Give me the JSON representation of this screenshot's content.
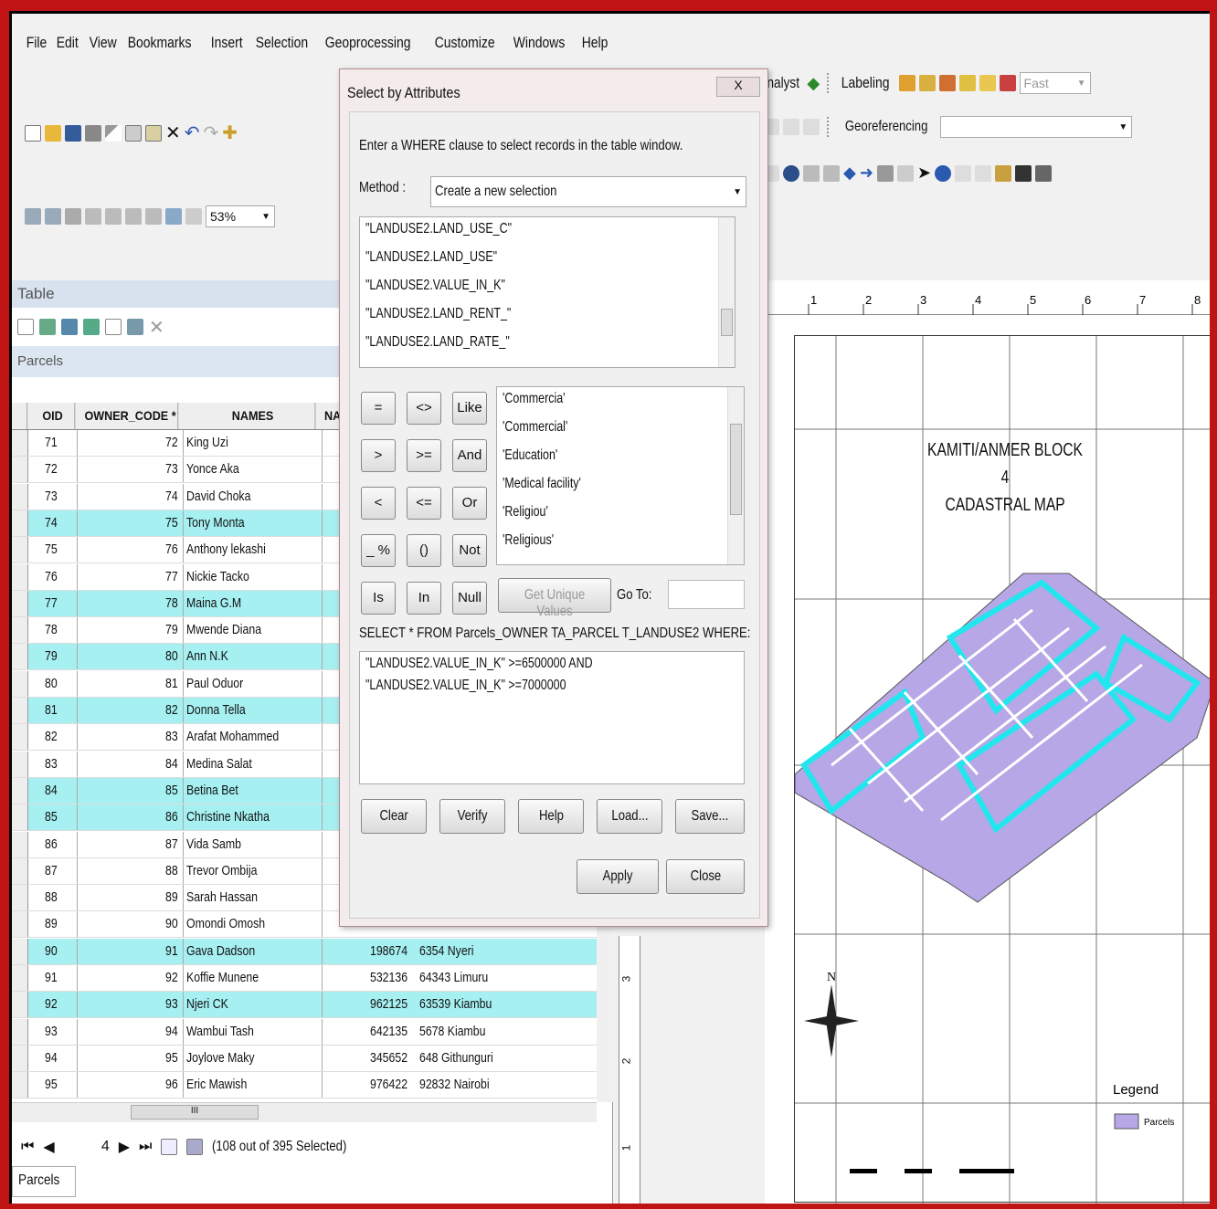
{
  "menu": [
    "File",
    "Edit",
    "View",
    "Bookmarks",
    "Insert",
    "Selection",
    "Geoprocessing",
    "Customize",
    "Windows",
    "Help"
  ],
  "toolbar": {
    "zoom": "53%",
    "analyst": "nalyst",
    "labeling": "Labeling",
    "fast": "Fast",
    "georeferencing": "Georeferencing"
  },
  "table": {
    "window_title": "Table",
    "tab": "Parcels",
    "columns": [
      "OID",
      "OWNER_CODE *",
      "NAMES",
      "NA"
    ],
    "rows": [
      {
        "oid": "71",
        "code": "72",
        "name": "King Uzi",
        "v1": "",
        "v2": "",
        "sel": false
      },
      {
        "oid": "72",
        "code": "73",
        "name": "Yonce Aka",
        "v1": "",
        "v2": "",
        "sel": false
      },
      {
        "oid": "73",
        "code": "74",
        "name": "David Choka",
        "v1": "",
        "v2": "",
        "sel": false
      },
      {
        "oid": "74",
        "code": "75",
        "name": "Tony Monta",
        "v1": "",
        "v2": "",
        "sel": true
      },
      {
        "oid": "75",
        "code": "76",
        "name": "Anthony lekashi",
        "v1": "",
        "v2": "",
        "sel": false
      },
      {
        "oid": "76",
        "code": "77",
        "name": "Nickie Tacko",
        "v1": "",
        "v2": "",
        "sel": false
      },
      {
        "oid": "77",
        "code": "78",
        "name": "Maina G.M",
        "v1": "",
        "v2": "",
        "sel": true
      },
      {
        "oid": "78",
        "code": "79",
        "name": "Mwende Diana",
        "v1": "",
        "v2": "",
        "sel": false
      },
      {
        "oid": "79",
        "code": "80",
        "name": "Ann N.K",
        "v1": "",
        "v2": "",
        "sel": true
      },
      {
        "oid": "80",
        "code": "81",
        "name": "Paul Oduor",
        "v1": "",
        "v2": "",
        "sel": false
      },
      {
        "oid": "81",
        "code": "82",
        "name": "Donna Tella",
        "v1": "",
        "v2": "",
        "sel": true
      },
      {
        "oid": "82",
        "code": "83",
        "name": "Arafat Mohammed",
        "v1": "",
        "v2": "",
        "sel": false
      },
      {
        "oid": "83",
        "code": "84",
        "name": "Medina Salat",
        "v1": "",
        "v2": "",
        "sel": false
      },
      {
        "oid": "84",
        "code": "85",
        "name": "Betina Bet",
        "v1": "",
        "v2": "",
        "sel": true
      },
      {
        "oid": "85",
        "code": "86",
        "name": "Christine Nkatha",
        "v1": "",
        "v2": "",
        "sel": true
      },
      {
        "oid": "86",
        "code": "87",
        "name": "Vida Samb",
        "v1": "",
        "v2": "",
        "sel": false
      },
      {
        "oid": "87",
        "code": "88",
        "name": "Trevor Ombija",
        "v1": "",
        "v2": "",
        "sel": false
      },
      {
        "oid": "88",
        "code": "89",
        "name": "Sarah Hassan",
        "v1": "",
        "v2": "",
        "sel": false
      },
      {
        "oid": "89",
        "code": "90",
        "name": "Omondi Omosh",
        "v1": "",
        "v2": "",
        "sel": false
      },
      {
        "oid": "90",
        "code": "91",
        "name": "Gava Dadson",
        "v1": "198674",
        "v2": "6354 Nyeri",
        "sel": true
      },
      {
        "oid": "91",
        "code": "92",
        "name": "Koffie Munene",
        "v1": "532136",
        "v2": "64343 Limuru",
        "sel": false
      },
      {
        "oid": "92",
        "code": "93",
        "name": "Njeri CK",
        "v1": "962125",
        "v2": "63539 Kiambu",
        "sel": true
      },
      {
        "oid": "93",
        "code": "94",
        "name": "Wambui Tash",
        "v1": "642135",
        "v2": "5678 Kiambu",
        "sel": false
      },
      {
        "oid": "94",
        "code": "95",
        "name": "Joylove Maky",
        "v1": "345652",
        "v2": "648 Githunguri",
        "sel": false
      },
      {
        "oid": "95",
        "code": "96",
        "name": "Eric Mawish",
        "v1": "976422",
        "v2": "92832 Nairobi",
        "sel": false
      }
    ],
    "record": "4",
    "status": "(108 out of 395 Selected)",
    "bottom_tab": "Parcels",
    "scroll_mid": "III"
  },
  "dialog": {
    "title": "Select by Attributes",
    "close": "X",
    "prompt": "Enter a WHERE clause to select records in the table window.",
    "method_label": "Method :",
    "method_value": "Create a new selection",
    "fields": [
      "\"LANDUSE2.LAND_USE_C\"",
      "\"LANDUSE2.LAND_USE\"",
      "\"LANDUSE2.VALUE_IN_K\"",
      "\"LANDUSE2.LAND_RENT_\"",
      "\"LANDUSE2.LAND_RATE_\""
    ],
    "operators": [
      "=",
      "<>",
      "Like",
      ">",
      ">=",
      "And",
      "<",
      "<=",
      "Or",
      "_ %",
      "()",
      "Not",
      "Is",
      "In",
      "Null"
    ],
    "values": [
      "'Commercia'",
      "'Commercial'",
      "'Education'",
      "'Medical facility'",
      "'Religiou'",
      "'Religious'"
    ],
    "get_unique": "Get Unique Values",
    "goto": "Go To:",
    "sql_prefix": "SELECT * FROM Parcels_OWNER TA_PARCEL T_LANDUSE2 WHERE:",
    "expression_line1": "\"LANDUSE2.VALUE_IN_K\" >=6500000 AND",
    "expression_line2": "\"LANDUSE2.VALUE_IN_K\" >=7000000",
    "buttons": {
      "clear": "Clear",
      "verify": "Verify",
      "help": "Help",
      "load": "Load...",
      "save": "Save...",
      "apply": "Apply",
      "close": "Close"
    }
  },
  "map": {
    "title_line1": "KAMITI/ANMER BLOCK 4",
    "title_line2": "CADASTRAL MAP",
    "north": "N",
    "legend_title": "Legend",
    "legend_item": "Parcels",
    "ruler_ticks": [
      "1",
      "2",
      "3",
      "4",
      "5",
      "6",
      "7",
      "8"
    ],
    "vruler_ticks": [
      "3",
      "2",
      "1"
    ],
    "colors": {
      "parcel_fill": "#b7a7e6",
      "highlight": "#22e6ee",
      "selection_row": "#a6f0f2"
    }
  }
}
